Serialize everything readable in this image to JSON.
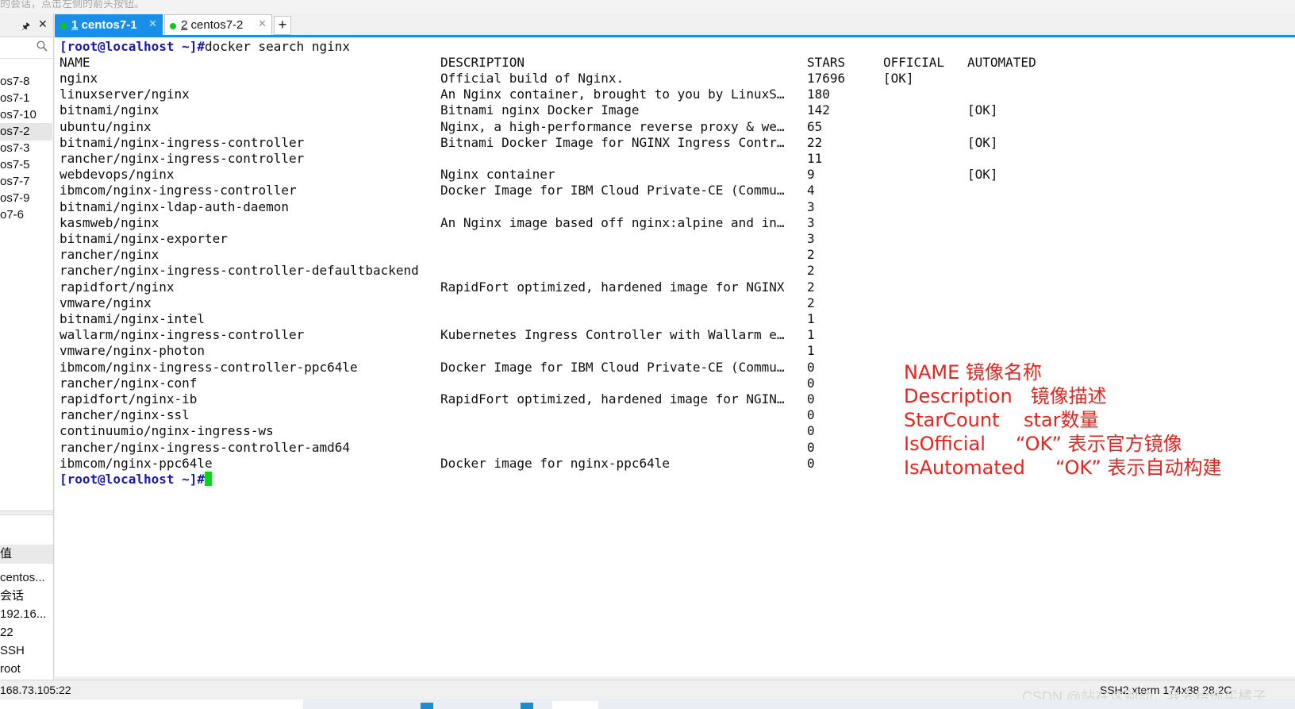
{
  "top_strip_text": "的会话，点击左侧的箭头按钮。",
  "left_panel": {
    "sessions": [
      "os7-8",
      "os7-1",
      "os7-10",
      "os7-2",
      "os7-3",
      "os7-5",
      "os7-7",
      "os7-9",
      "o7-6"
    ],
    "selected_index": 3,
    "props_header": "值",
    "props": [
      "centos...",
      "会话",
      "192.16...",
      "22",
      "SSH",
      "root"
    ]
  },
  "tabs": [
    {
      "number": "1",
      "label": " centos7-1",
      "active": true
    },
    {
      "number": "2",
      "label": " centos7-2",
      "active": false
    }
  ],
  "tab_add_label": "+",
  "terminal": {
    "prompt": "[root@localhost ~]#",
    "command": "docker search nginx",
    "headers": {
      "name": "NAME",
      "description": "DESCRIPTION",
      "stars": "STARS",
      "official": "OFFICIAL",
      "automated": "AUTOMATED"
    },
    "rows": [
      {
        "name": "nginx",
        "description": "Official build of Nginx.",
        "stars": "17696",
        "official": "[OK]",
        "automated": ""
      },
      {
        "name": "linuxserver/nginx",
        "description": "An Nginx container, brought to you by LinuxS…",
        "stars": "180",
        "official": "",
        "automated": ""
      },
      {
        "name": "bitnami/nginx",
        "description": "Bitnami nginx Docker Image",
        "stars": "142",
        "official": "",
        "automated": "[OK]"
      },
      {
        "name": "ubuntu/nginx",
        "description": "Nginx, a high-performance reverse proxy & we…",
        "stars": "65",
        "official": "",
        "automated": ""
      },
      {
        "name": "bitnami/nginx-ingress-controller",
        "description": "Bitnami Docker Image for NGINX Ingress Contr…",
        "stars": "22",
        "official": "",
        "automated": "[OK]"
      },
      {
        "name": "rancher/nginx-ingress-controller",
        "description": "",
        "stars": "11",
        "official": "",
        "automated": ""
      },
      {
        "name": "webdevops/nginx",
        "description": "Nginx container",
        "stars": "9",
        "official": "",
        "automated": "[OK]"
      },
      {
        "name": "ibmcom/nginx-ingress-controller",
        "description": "Docker Image for IBM Cloud Private-CE (Commu…",
        "stars": "4",
        "official": "",
        "automated": ""
      },
      {
        "name": "bitnami/nginx-ldap-auth-daemon",
        "description": "",
        "stars": "3",
        "official": "",
        "automated": ""
      },
      {
        "name": "kasmweb/nginx",
        "description": "An Nginx image based off nginx:alpine and in…",
        "stars": "3",
        "official": "",
        "automated": ""
      },
      {
        "name": "bitnami/nginx-exporter",
        "description": "",
        "stars": "3",
        "official": "",
        "automated": ""
      },
      {
        "name": "rancher/nginx",
        "description": "",
        "stars": "2",
        "official": "",
        "automated": ""
      },
      {
        "name": "rancher/nginx-ingress-controller-defaultbackend",
        "description": "",
        "stars": "2",
        "official": "",
        "automated": ""
      },
      {
        "name": "rapidfort/nginx",
        "description": "RapidFort optimized, hardened image for NGINX",
        "stars": "2",
        "official": "",
        "automated": ""
      },
      {
        "name": "vmware/nginx",
        "description": "",
        "stars": "2",
        "official": "",
        "automated": ""
      },
      {
        "name": "bitnami/nginx-intel",
        "description": "",
        "stars": "1",
        "official": "",
        "automated": ""
      },
      {
        "name": "wallarm/nginx-ingress-controller",
        "description": "Kubernetes Ingress Controller with Wallarm e…",
        "stars": "1",
        "official": "",
        "automated": ""
      },
      {
        "name": "vmware/nginx-photon",
        "description": "",
        "stars": "1",
        "official": "",
        "automated": ""
      },
      {
        "name": "ibmcom/nginx-ingress-controller-ppc64le",
        "description": "Docker Image for IBM Cloud Private-CE (Commu…",
        "stars": "0",
        "official": "",
        "automated": ""
      },
      {
        "name": "rancher/nginx-conf",
        "description": "",
        "stars": "0",
        "official": "",
        "automated": ""
      },
      {
        "name": "rapidfort/nginx-ib",
        "description": "RapidFort optimized, hardened image for NGIN…",
        "stars": "0",
        "official": "",
        "automated": ""
      },
      {
        "name": "rancher/nginx-ssl",
        "description": "",
        "stars": "0",
        "official": "",
        "automated": ""
      },
      {
        "name": "continuumio/nginx-ingress-ws",
        "description": "",
        "stars": "0",
        "official": "",
        "automated": ""
      },
      {
        "name": "rancher/nginx-ingress-controller-amd64",
        "description": "",
        "stars": "0",
        "official": "",
        "automated": ""
      },
      {
        "name": "ibmcom/nginx-ppc64le",
        "description": "Docker image for nginx-ppc64le",
        "stars": "0",
        "official": "",
        "automated": ""
      }
    ],
    "cursor_color": "#0fd31a",
    "prompt_color": "#1a1ab0"
  },
  "annotations": [
    "NAME 镜像名称",
    "Description   镜像描述",
    "StarCount    star数量",
    "IsOfficial     “OK” 表示官方镜像",
    "IsAutomated     “OK” 表示自动构建"
  ],
  "annotation_color": "#e8231e",
  "status_bar": {
    "left": "168.73.105:22",
    "right": "SSH2    xterm    174x38    28,2C"
  },
  "watermark": "CSDN @站在这别动，我去给你买橘子",
  "accent_color": "#1a8fe8"
}
